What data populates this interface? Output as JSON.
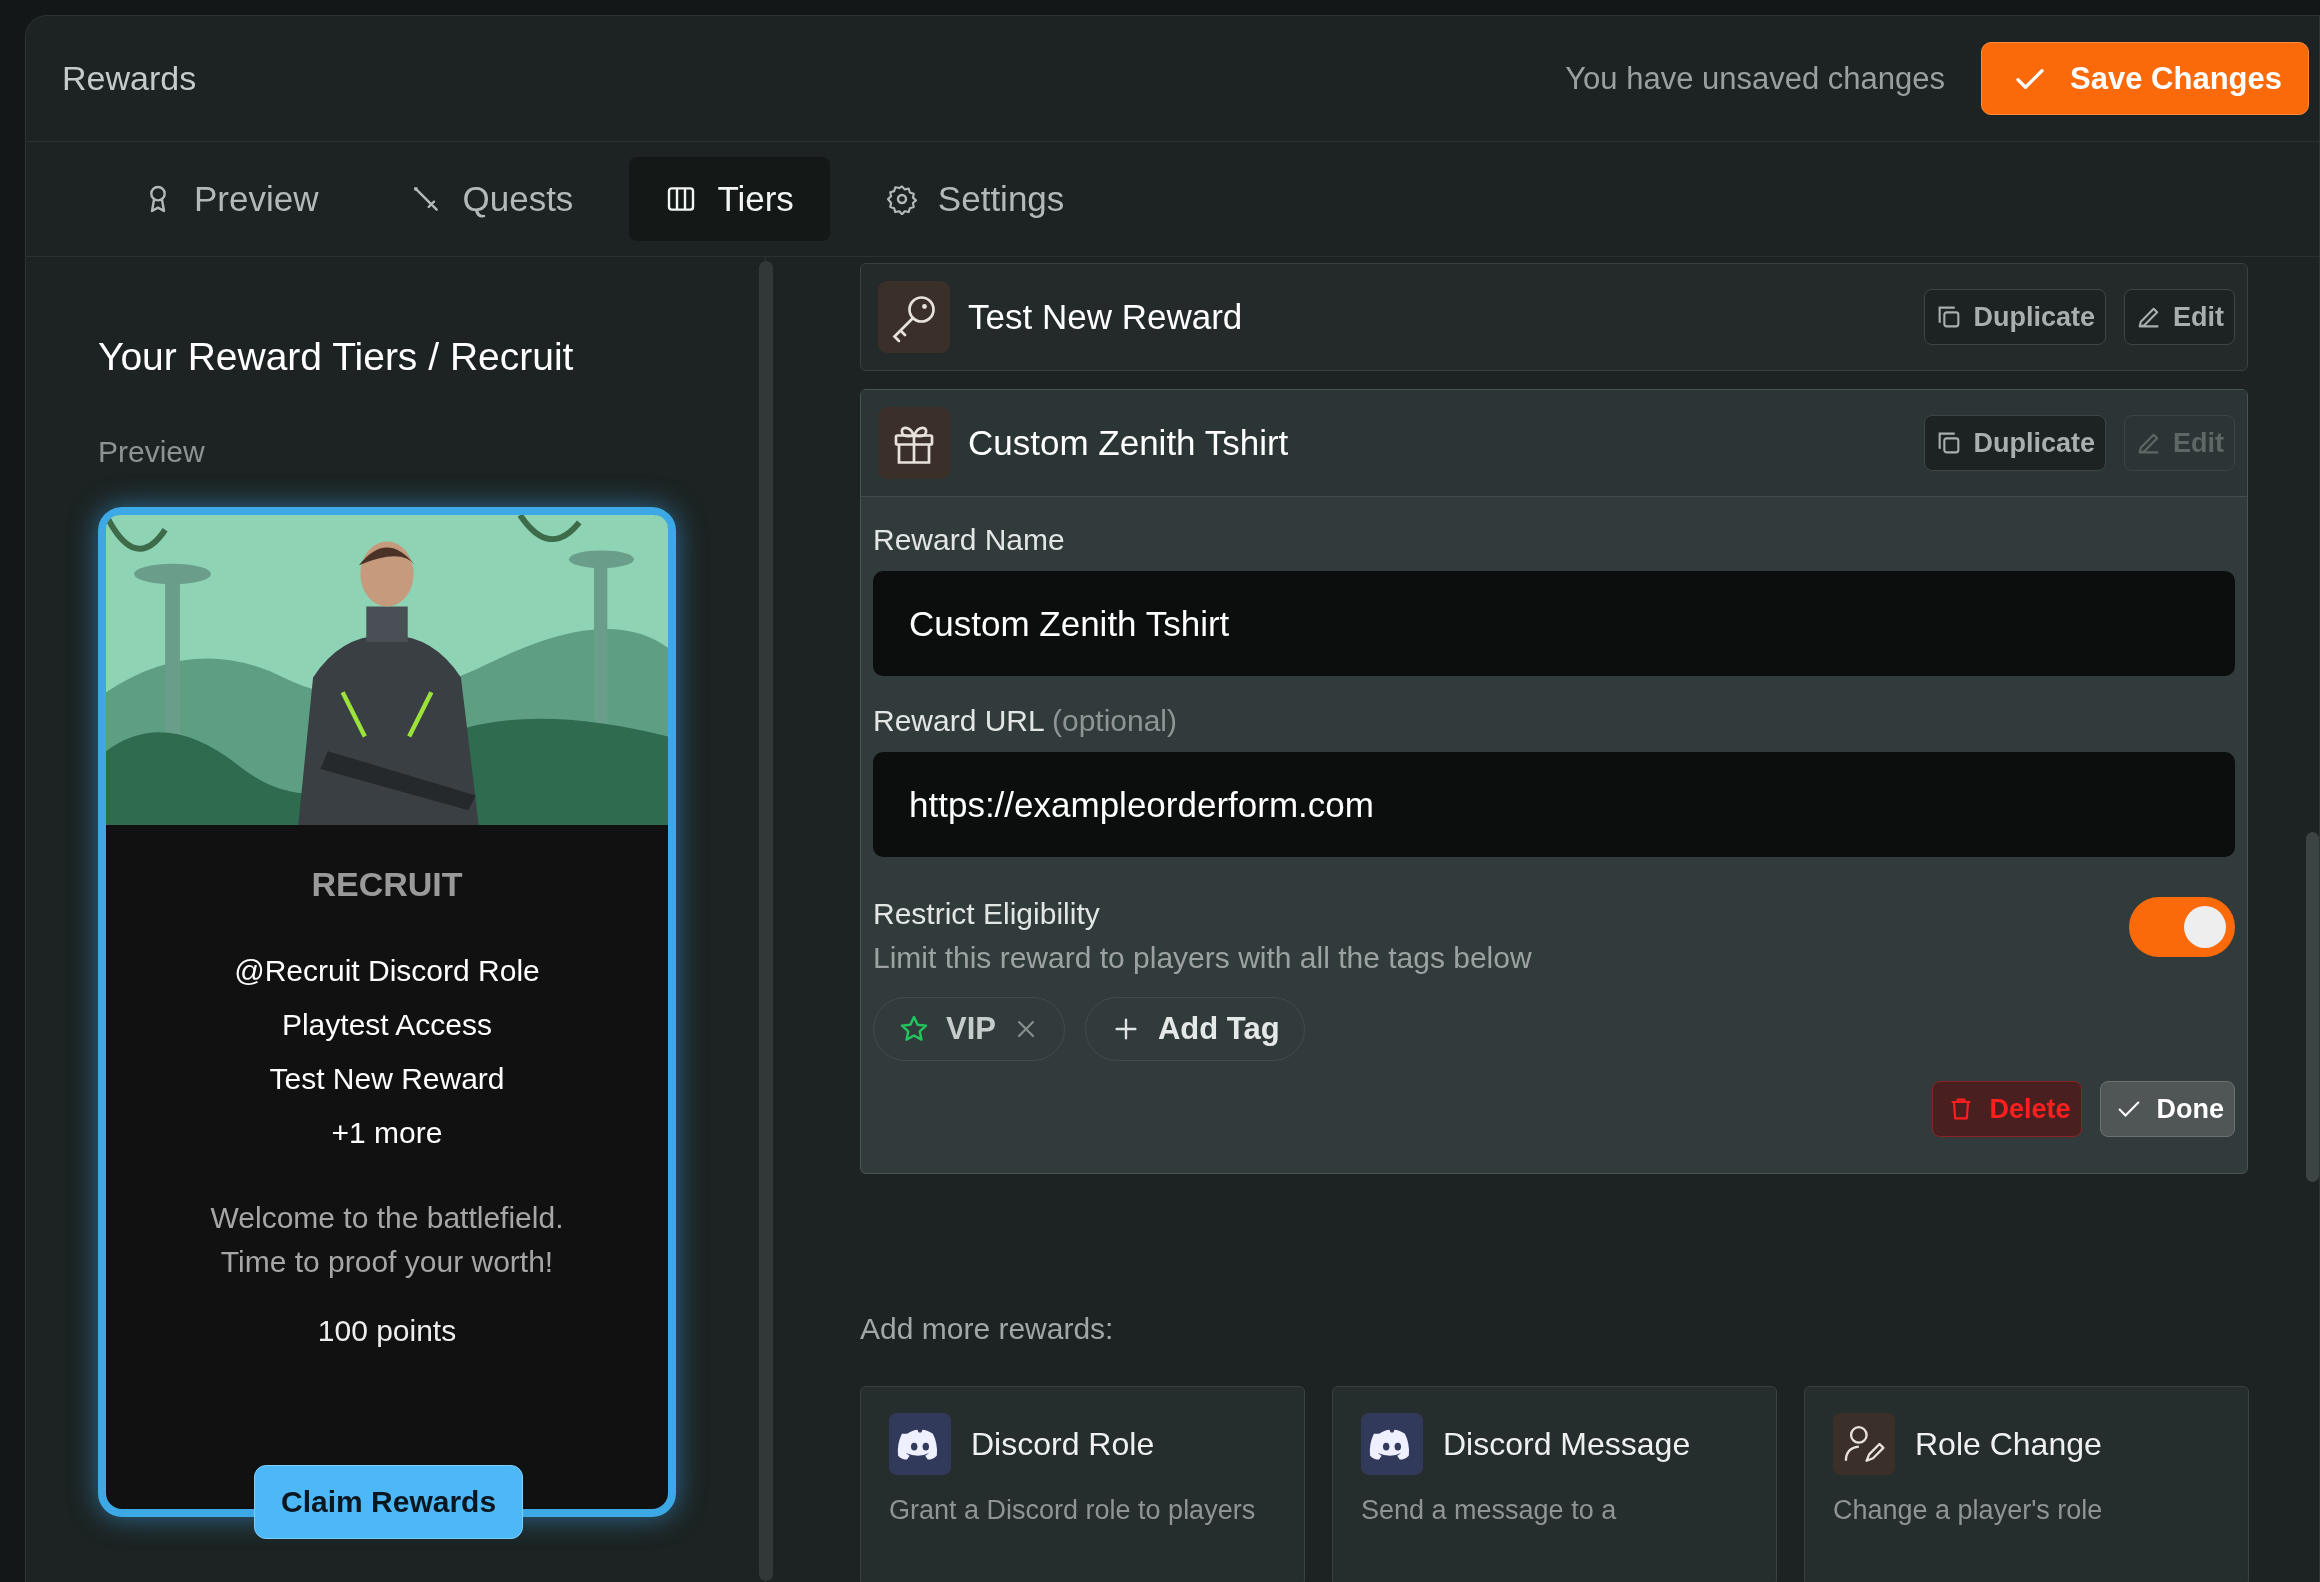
{
  "header": {
    "title": "Rewards",
    "status": "You have unsaved changes",
    "save_button": "Save Changes"
  },
  "tabs": [
    {
      "label": "Preview",
      "selected": false
    },
    {
      "label": "Quests",
      "selected": false
    },
    {
      "label": "Tiers",
      "selected": true
    },
    {
      "label": "Settings",
      "selected": false
    }
  ],
  "sidebar": {
    "title": "Your Reward Tiers / Recruit",
    "section_label": "Preview",
    "card": {
      "tier": "RECRUIT",
      "rewards": [
        "@Recruit Discord Role",
        "Playtest Access",
        "Test New Reward",
        "+1 more"
      ],
      "description": "Welcome to the battlefield. Time to proof your worth!",
      "points": "100 points",
      "claim_button": "Claim Rewards"
    }
  },
  "rewards": [
    {
      "kind": "key",
      "title": "Test New Reward",
      "expanded": false,
      "duplicate": "Duplicate",
      "edit": "Edit",
      "edit_disabled": false
    },
    {
      "kind": "gift",
      "title": "Custom Zenith Tshirt",
      "expanded": true,
      "duplicate": "Duplicate",
      "edit": "Edit",
      "edit_disabled": true,
      "form": {
        "name_label": "Reward Name",
        "name_value": "Custom Zenith Tshirt",
        "url_label": "Reward URL",
        "url_hint": "(optional)",
        "url_value": "https://exampleorderform.com",
        "restrict_title": "Restrict Eligibility",
        "restrict_description": "Limit this reward to players with all the tags below",
        "restrict_on": true,
        "tags": [
          {
            "label": "VIP"
          }
        ],
        "add_tag": "Add Tag",
        "delete_button": "Delete",
        "done_button": "Done"
      }
    }
  ],
  "add_more": {
    "label": "Add more rewards:",
    "options": [
      {
        "kind": "discord",
        "title": "Discord Role",
        "description": "Grant a Discord role to players"
      },
      {
        "kind": "discord",
        "title": "Discord Message",
        "description": "Send a message to a"
      },
      {
        "kind": "role",
        "title": "Role Change",
        "description": "Change a player's role"
      }
    ]
  }
}
